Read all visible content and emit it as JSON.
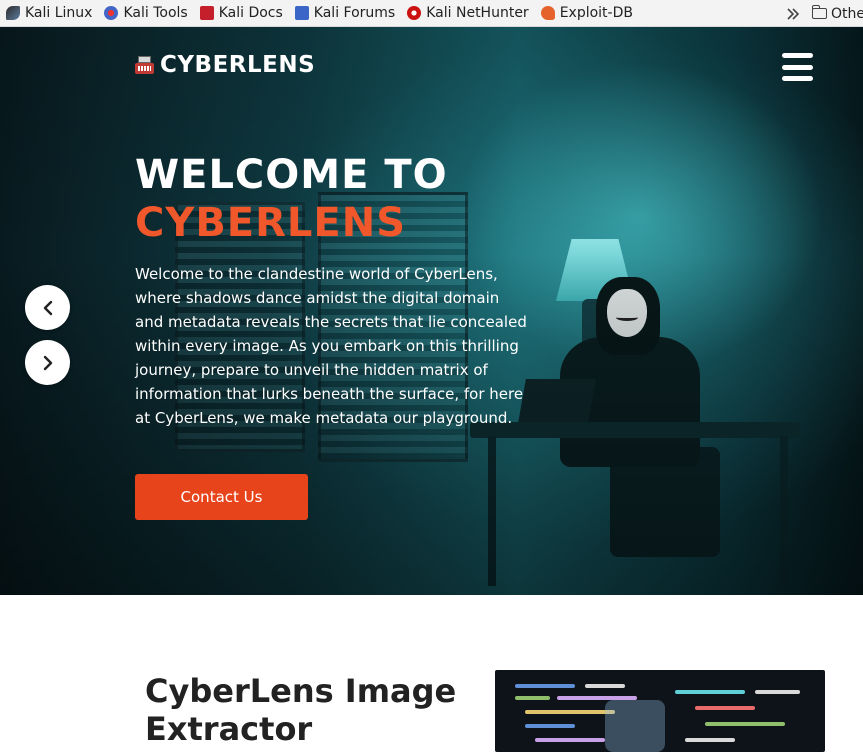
{
  "bookmarks": {
    "items": [
      {
        "label": "Kali Linux",
        "icon": "kali-linux-icon"
      },
      {
        "label": "Kali Tools",
        "icon": "kali-tools-icon"
      },
      {
        "label": "Kali Docs",
        "icon": "kali-docs-icon"
      },
      {
        "label": "Kali Forums",
        "icon": "kali-forums-icon"
      },
      {
        "label": "Kali NetHunter",
        "icon": "kali-nethunter-icon"
      },
      {
        "label": "Exploit-DB",
        "icon": "exploit-db-icon"
      }
    ],
    "more_icon": "double-chevron-right-icon",
    "other_label": "Othe"
  },
  "header": {
    "brand": "CYBERLENS",
    "brand_icon": "typewriter-icon",
    "menu_icon": "hamburger-menu-icon"
  },
  "hero": {
    "title_line1": "WELCOME TO",
    "title_line2": "CYBERLENS",
    "intro": "Welcome to the clandestine world of CyberLens, where shadows dance amidst the digital domain and metadata reveals the secrets that lie concealed within every image. As you embark on this thrilling journey, prepare to unveil the hidden matrix of information that lurks beneath the surface, for here at CyberLens, we make metadata our playground.",
    "cta_label": "Contact Us",
    "prev_icon": "chevron-left-icon",
    "next_icon": "chevron-right-icon"
  },
  "section": {
    "title": "CyberLens Image Extractor"
  },
  "colors": {
    "accent": "#e8441c",
    "accent_text": "#f0582b",
    "hero_teal": "#17616a"
  }
}
